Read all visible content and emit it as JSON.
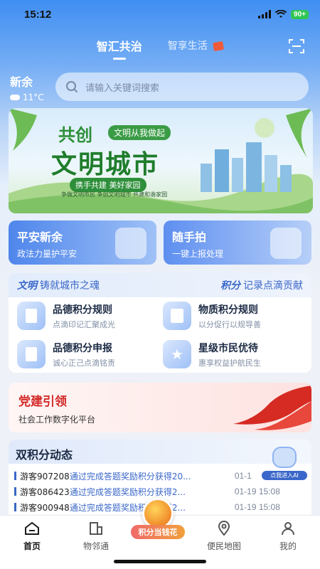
{
  "status_bar": {
    "time": "15:12",
    "battery": "90+"
  },
  "header": {
    "tabs": [
      {
        "label": "智汇共治",
        "active": true
      },
      {
        "label": "智享生活",
        "active": false
      }
    ]
  },
  "location": {
    "city": "新余",
    "temperature": "11°C",
    "weather_icon": "cloud-icon"
  },
  "search": {
    "placeholder": "请输入关键词搜索"
  },
  "banner": {
    "title_top": "共创",
    "tagline": "文明从我做起",
    "title_main": "文明城市",
    "slogan": "携手共建 美好家园",
    "caption": "争做文明市民 争创文明城市 共建和谐家园"
  },
  "quick_cards": [
    {
      "title": "平安新余",
      "subtitle": "政法力量护平安"
    },
    {
      "title": "随手拍",
      "subtitle": "一键上报处理"
    }
  ],
  "points_section": {
    "left_accent": "文明",
    "left_title": "铸就城市之魂",
    "right_accent": "积分",
    "right_title": "记录点滴贡献",
    "items": [
      {
        "title": "品德积分规则",
        "subtitle": "点滴印记汇聚成光"
      },
      {
        "title": "物质积分规则",
        "subtitle": "以分促行以规导善"
      },
      {
        "title": "品德积分申报",
        "subtitle": "诚心正己点滴铭责"
      },
      {
        "title": "星级市民优待",
        "subtitle": "惠享权益护航民生"
      }
    ]
  },
  "party": {
    "title": "党建引领",
    "subtitle": "社会工作数字化平台"
  },
  "feed": {
    "title": "双积分动态",
    "ai_label": "点我进入AI",
    "rows": [
      {
        "user": "游客907208",
        "text": "通过完成答题奖励积分获得20...",
        "time": "01-1"
      },
      {
        "user": "游客086423",
        "text": "通过完成答题奖励积分获得2...",
        "time": "01-19 15:08"
      },
      {
        "user": "游客900948",
        "text": "通过完成答题奖励积分获得2...",
        "time": "01-19 15:08"
      }
    ]
  },
  "bottom_nav": {
    "items": [
      {
        "label": "首页",
        "active": true
      },
      {
        "label": "物邻通",
        "active": false
      },
      {
        "label": "便民地图",
        "active": false
      },
      {
        "label": "我的",
        "active": false
      }
    ],
    "center_label": "积分当钱花"
  },
  "colors": {
    "primary": "#3a67c9",
    "party_red": "#d32a28",
    "green": "#2e8f3a"
  }
}
